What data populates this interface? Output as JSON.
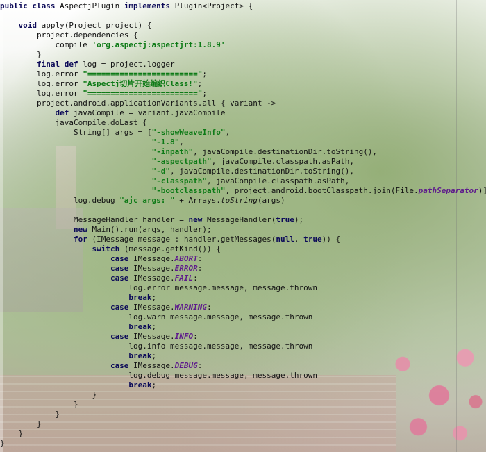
{
  "editor": {
    "lines": [
      [
        [
          "kw",
          "public class "
        ],
        [
          "plain",
          "AspectjPlugin "
        ],
        [
          "kw",
          "implements "
        ],
        [
          "plain",
          "Plugin<Project> {"
        ]
      ],
      [],
      [
        [
          "kw",
          "    void "
        ],
        [
          "plain",
          "apply(Project project) {"
        ]
      ],
      [
        [
          "plain",
          "        project.dependencies {"
        ]
      ],
      [
        [
          "plain",
          "            compile "
        ],
        [
          "str",
          "'org.aspectj:aspectjrt:1.8.9'"
        ]
      ],
      [
        [
          "plain",
          "        }"
        ]
      ],
      [
        [
          "kw",
          "        final def "
        ],
        [
          "plain",
          "log = project.logger"
        ]
      ],
      [
        [
          "plain",
          "        log.error "
        ],
        [
          "str",
          "\"========================\""
        ],
        [
          "plain",
          ";"
        ]
      ],
      [
        [
          "plain",
          "        log.error "
        ],
        [
          "str",
          "\"Aspectj切片开始编织Class!\""
        ],
        [
          "plain",
          ";"
        ]
      ],
      [
        [
          "plain",
          "        log.error "
        ],
        [
          "str",
          "\"========================\""
        ],
        [
          "plain",
          ";"
        ]
      ],
      [
        [
          "plain",
          "        project.android.applicationVariants.all { variant ->"
        ]
      ],
      [
        [
          "kw",
          "            def "
        ],
        [
          "plain",
          "javaCompile = variant.javaCompile"
        ]
      ],
      [
        [
          "plain",
          "            javaCompile.doLast {"
        ]
      ],
      [
        [
          "plain",
          "                String[] args = ["
        ],
        [
          "str",
          "\"-showWeaveInfo\""
        ],
        [
          "plain",
          ","
        ]
      ],
      [
        [
          "str",
          "                                 \"-1.8\""
        ],
        [
          "plain",
          ","
        ]
      ],
      [
        [
          "str",
          "                                 \"-inpath\""
        ],
        [
          "plain",
          ", javaCompile.destinationDir.toString(),"
        ]
      ],
      [
        [
          "str",
          "                                 \"-aspectpath\""
        ],
        [
          "plain",
          ", javaCompile.classpath.asPath,"
        ]
      ],
      [
        [
          "str",
          "                                 \"-d\""
        ],
        [
          "plain",
          ", javaCompile.destinationDir.toString(),"
        ]
      ],
      [
        [
          "str",
          "                                 \"-classpath\""
        ],
        [
          "plain",
          ", javaCompile.classpath.asPath,"
        ]
      ],
      [
        [
          "str",
          "                                 \"-bootclasspath\""
        ],
        [
          "plain",
          ", project.android.bootClasspath.join(File."
        ],
        [
          "ital",
          "pathSeparator"
        ],
        [
          "plain",
          ")]"
        ]
      ],
      [
        [
          "plain",
          "                log.debug "
        ],
        [
          "str",
          "\"ajc args: \""
        ],
        [
          "plain",
          " + Arrays."
        ],
        [
          "meth",
          "toString"
        ],
        [
          "plain",
          "(args)"
        ]
      ],
      [],
      [
        [
          "plain",
          "                MessageHandler handler = "
        ],
        [
          "kw",
          "new "
        ],
        [
          "plain",
          "MessageHandler("
        ],
        [
          "kw",
          "true"
        ],
        [
          "plain",
          ");"
        ]
      ],
      [
        [
          "kw",
          "                new "
        ],
        [
          "plain",
          "Main().run(args, handler);"
        ]
      ],
      [
        [
          "kw",
          "                for "
        ],
        [
          "plain",
          "(IMessage message : handler.getMessages("
        ],
        [
          "kw",
          "null"
        ],
        [
          "plain",
          ", "
        ],
        [
          "kw",
          "true"
        ],
        [
          "plain",
          ")) {"
        ]
      ],
      [
        [
          "kw",
          "                    switch "
        ],
        [
          "plain",
          "(message.getKind()) {"
        ]
      ],
      [
        [
          "kw",
          "                        case "
        ],
        [
          "plain",
          "IMessage."
        ],
        [
          "ital",
          "ABORT"
        ],
        [
          "plain",
          ":"
        ]
      ],
      [
        [
          "kw",
          "                        case "
        ],
        [
          "plain",
          "IMessage."
        ],
        [
          "ital",
          "ERROR"
        ],
        [
          "plain",
          ":"
        ]
      ],
      [
        [
          "kw",
          "                        case "
        ],
        [
          "plain",
          "IMessage."
        ],
        [
          "ital",
          "FAIL"
        ],
        [
          "plain",
          ":"
        ]
      ],
      [
        [
          "plain",
          "                            log.error message.message, message.thrown"
        ]
      ],
      [
        [
          "kw",
          "                            break"
        ],
        [
          "plain",
          ";"
        ]
      ],
      [
        [
          "kw",
          "                        case "
        ],
        [
          "plain",
          "IMessage."
        ],
        [
          "ital",
          "WARNING"
        ],
        [
          "plain",
          ":"
        ]
      ],
      [
        [
          "plain",
          "                            log.warn message.message, message.thrown"
        ]
      ],
      [
        [
          "kw",
          "                            break"
        ],
        [
          "plain",
          ";"
        ]
      ],
      [
        [
          "kw",
          "                        case "
        ],
        [
          "plain",
          "IMessage."
        ],
        [
          "ital",
          "INFO"
        ],
        [
          "plain",
          ":"
        ]
      ],
      [
        [
          "plain",
          "                            log.info message.message, message.thrown"
        ]
      ],
      [
        [
          "kw",
          "                            break"
        ],
        [
          "plain",
          ";"
        ]
      ],
      [
        [
          "kw",
          "                        case "
        ],
        [
          "plain",
          "IMessage."
        ],
        [
          "ital",
          "DEBUG"
        ],
        [
          "plain",
          ":"
        ]
      ],
      [
        [
          "plain",
          "                            log.debug message.message, message.thrown"
        ]
      ],
      [
        [
          "kw",
          "                            break"
        ],
        [
          "plain",
          ";"
        ]
      ],
      [
        [
          "plain",
          "                    }"
        ]
      ],
      [
        [
          "plain",
          "                }"
        ]
      ],
      [
        [
          "plain",
          "            }"
        ]
      ],
      [
        [
          "plain",
          "        }"
        ]
      ],
      [
        [
          "plain",
          "    }"
        ]
      ],
      [
        [
          "plain",
          "}"
        ]
      ]
    ]
  }
}
